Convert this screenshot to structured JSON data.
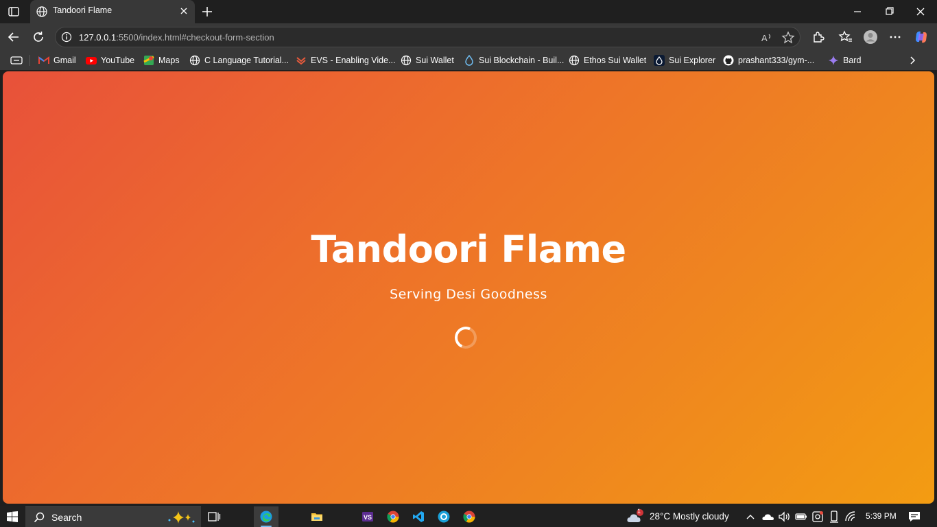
{
  "browser": {
    "tab_title": "Tandoori Flame",
    "url_host": "127.0.0.1",
    "url_rest": ":5500/index.html#checkout-form-section"
  },
  "favorites": [
    {
      "label": "Gmail",
      "icon": "gmail-icon"
    },
    {
      "label": "YouTube",
      "icon": "youtube-icon"
    },
    {
      "label": "Maps",
      "icon": "maps-icon"
    },
    {
      "label": "C Language Tutorial...",
      "icon": "globe-icon"
    },
    {
      "label": "EVS - Enabling Vide...",
      "icon": "evs-icon"
    },
    {
      "label": "Sui Wallet",
      "icon": "globe-icon"
    },
    {
      "label": "Sui Blockchain - Buil...",
      "icon": "sui-drop-icon"
    },
    {
      "label": "Ethos Sui Wallet",
      "icon": "globe-icon"
    },
    {
      "label": "Sui Explorer",
      "icon": "sui-drop-icon"
    },
    {
      "label": "prashant333/gym-...",
      "icon": "github-icon"
    },
    {
      "label": "Bard",
      "icon": "bard-icon"
    }
  ],
  "page": {
    "title": "Tandoori Flame",
    "subtitle": "Serving Desi Goodness"
  },
  "taskbar": {
    "search_label": "Search",
    "weather": "28°C  Mostly cloudy",
    "weather_badge": "1",
    "time": "5:39 PM"
  },
  "colors": {
    "gradient_start": "#e8513a",
    "gradient_end": "#f39c12"
  }
}
